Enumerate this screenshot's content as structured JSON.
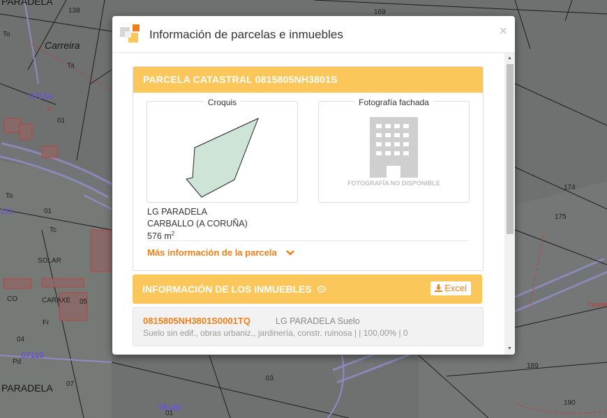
{
  "map": {
    "labels": [
      {
        "text": "PARADELA"
      },
      {
        "text": "138"
      },
      {
        "text": "169"
      },
      {
        "text": "Carreira"
      },
      {
        "text": "Ta"
      },
      {
        "text": "To"
      },
      {
        "text": "07154"
      },
      {
        "text": "b"
      },
      {
        "text": "01"
      },
      {
        "text": "To"
      },
      {
        "text": "151"
      },
      {
        "text": "01"
      },
      {
        "text": "Tc"
      },
      {
        "text": "SOLAR"
      },
      {
        "text": "CO"
      },
      {
        "text": "CARAXE"
      },
      {
        "text": "05"
      },
      {
        "text": "Fr"
      },
      {
        "text": "04"
      },
      {
        "text": "Pd"
      },
      {
        "text": "07119"
      },
      {
        "text": "PARADELA"
      },
      {
        "text": "07"
      },
      {
        "text": "03"
      },
      {
        "text": "08148"
      },
      {
        "text": "01"
      },
      {
        "text": "174"
      },
      {
        "text": "175"
      },
      {
        "text": "189"
      },
      {
        "text": "190"
      },
      {
        "text": "Parade"
      }
    ]
  },
  "dialog": {
    "title": "Información de parcelas e inmuebles",
    "close_icon": "×",
    "parcela": {
      "header": "PARCELA CATASTRAL 0815805NH3801S",
      "croquis_label": "Croquis",
      "foto_label": "Fotografía fachada",
      "no_photo_text": "FOTOGRAFÍA NO DISPONIBLE",
      "address_line1": "LG PARADELA",
      "address_line2": "CARBALLO (A CORUÑA)",
      "area": "576 m",
      "area_unit_sup": "2",
      "mas_info": "Más información de la parcela"
    },
    "inmuebles": {
      "header": "INFORMACIÓN DE LOS INMUEBLES",
      "excel_label": "Excel",
      "rows": [
        {
          "ref": "0815805NH3801S0001TQ",
          "location": "LG PARADELA Suelo",
          "description": "Suelo sin edif., obras urbaniz., jardinería, constr. ruinosa | | 100,00% | 0"
        }
      ]
    }
  },
  "colors": {
    "accent_orange": "#ef7f1a",
    "header_yellow": "#fbc75a",
    "map_background": "#6f7270",
    "parcel_fill": "#cde4d6"
  }
}
